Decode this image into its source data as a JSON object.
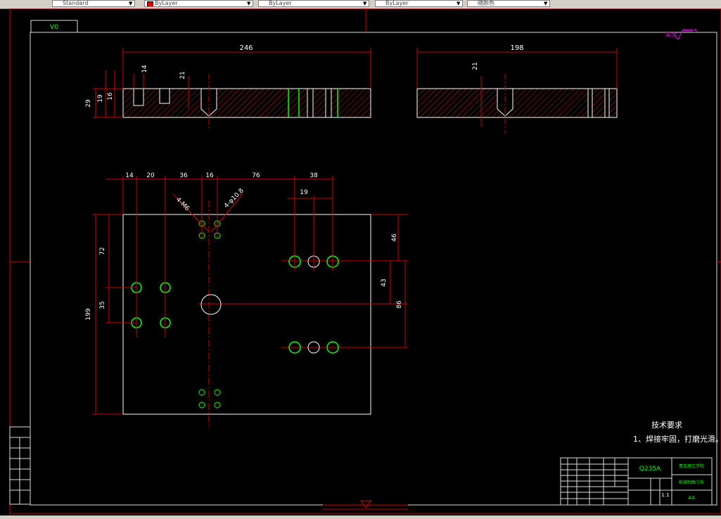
{
  "toolbar": {
    "style_value": "Standard",
    "color_value": "ByLayer",
    "linetype_value": "ByLayer",
    "lineweight_value": "ByLayer",
    "plot_style_value": "随颜色"
  },
  "drawing": {
    "sheet_label": "V0",
    "surface_finish": "Ra6.3",
    "surface_prefix": "其余",
    "top_view": {
      "dims": [
        "246",
        "14",
        "21",
        "29",
        "19",
        "16"
      ]
    },
    "side_view": {
      "dims": [
        "198",
        "21"
      ]
    },
    "plan_view": {
      "dims_top": [
        "14",
        "20",
        "36",
        "16",
        "76",
        "38",
        "19"
      ],
      "dims_left": [
        "199",
        "72",
        "35"
      ],
      "dims_right": [
        "46",
        "43",
        "86"
      ],
      "callout_m6": "4-M6",
      "callout_hole": "4-φ10.8"
    },
    "notes_title": "技术要求",
    "notes_item": "1、焊接牢固，打磨光滑。",
    "title_block": {
      "material": "Q235A",
      "company": "青岛理工学院",
      "part_name": "机械制图习作",
      "scale": "1:1",
      "sheet_size": "A4"
    }
  }
}
